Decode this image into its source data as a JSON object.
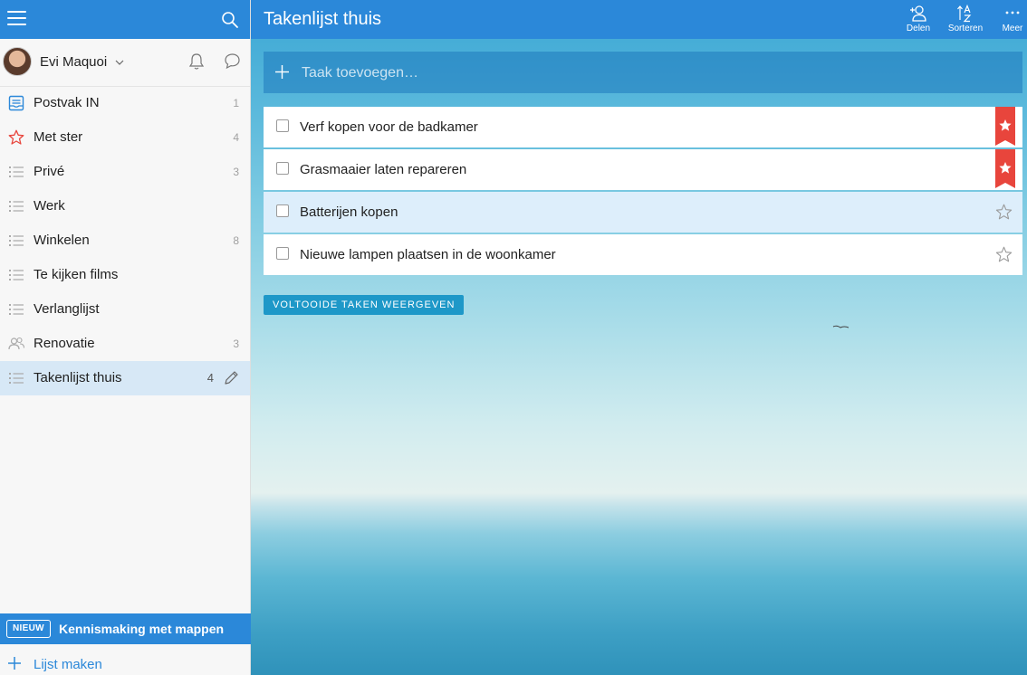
{
  "sidebar": {
    "user": {
      "name": "Evi Maquoi"
    },
    "lists": [
      {
        "label": "Postvak IN",
        "count": "1",
        "icon": "inbox-icon"
      },
      {
        "label": "Met ster",
        "count": "4",
        "icon": "star-icon"
      },
      {
        "label": "Privé",
        "count": "3",
        "icon": "list-icon"
      },
      {
        "label": "Werk",
        "count": "",
        "icon": "list-icon"
      },
      {
        "label": "Winkelen",
        "count": "8",
        "icon": "list-icon"
      },
      {
        "label": "Te kijken films",
        "count": "",
        "icon": "list-icon"
      },
      {
        "label": "Verlanglijst",
        "count": "",
        "icon": "list-icon"
      },
      {
        "label": "Renovatie",
        "count": "3",
        "icon": "shared-list-icon"
      },
      {
        "label": "Takenlijst thuis",
        "count": "4",
        "icon": "list-icon",
        "active": true
      }
    ],
    "promo": {
      "badge": "NIEUW",
      "text": "Kennismaking met mappen"
    },
    "new_list_label": "Lijst maken"
  },
  "main": {
    "title": "Takenlijst thuis",
    "toolbar": {
      "share_label": "Delen",
      "sort_label": "Sorteren",
      "more_label": "Meer"
    },
    "add_task": {
      "placeholder": "Taak toevoegen…"
    },
    "tasks": [
      {
        "title": "Verf kopen voor de badkamer",
        "starred": true
      },
      {
        "title": "Grasmaaier laten repareren",
        "starred": true
      },
      {
        "title": "Batterijen kopen",
        "starred": false,
        "selected": true
      },
      {
        "title": "Nieuwe lampen plaatsen in de woonkamer",
        "starred": false
      }
    ],
    "show_completed_label": "VOLTOOIDE TAKEN WEERGEVEN"
  },
  "colors": {
    "accent": "#2b88d9",
    "star_flag": "#e8453c",
    "selected_row": "#ddeefb"
  }
}
